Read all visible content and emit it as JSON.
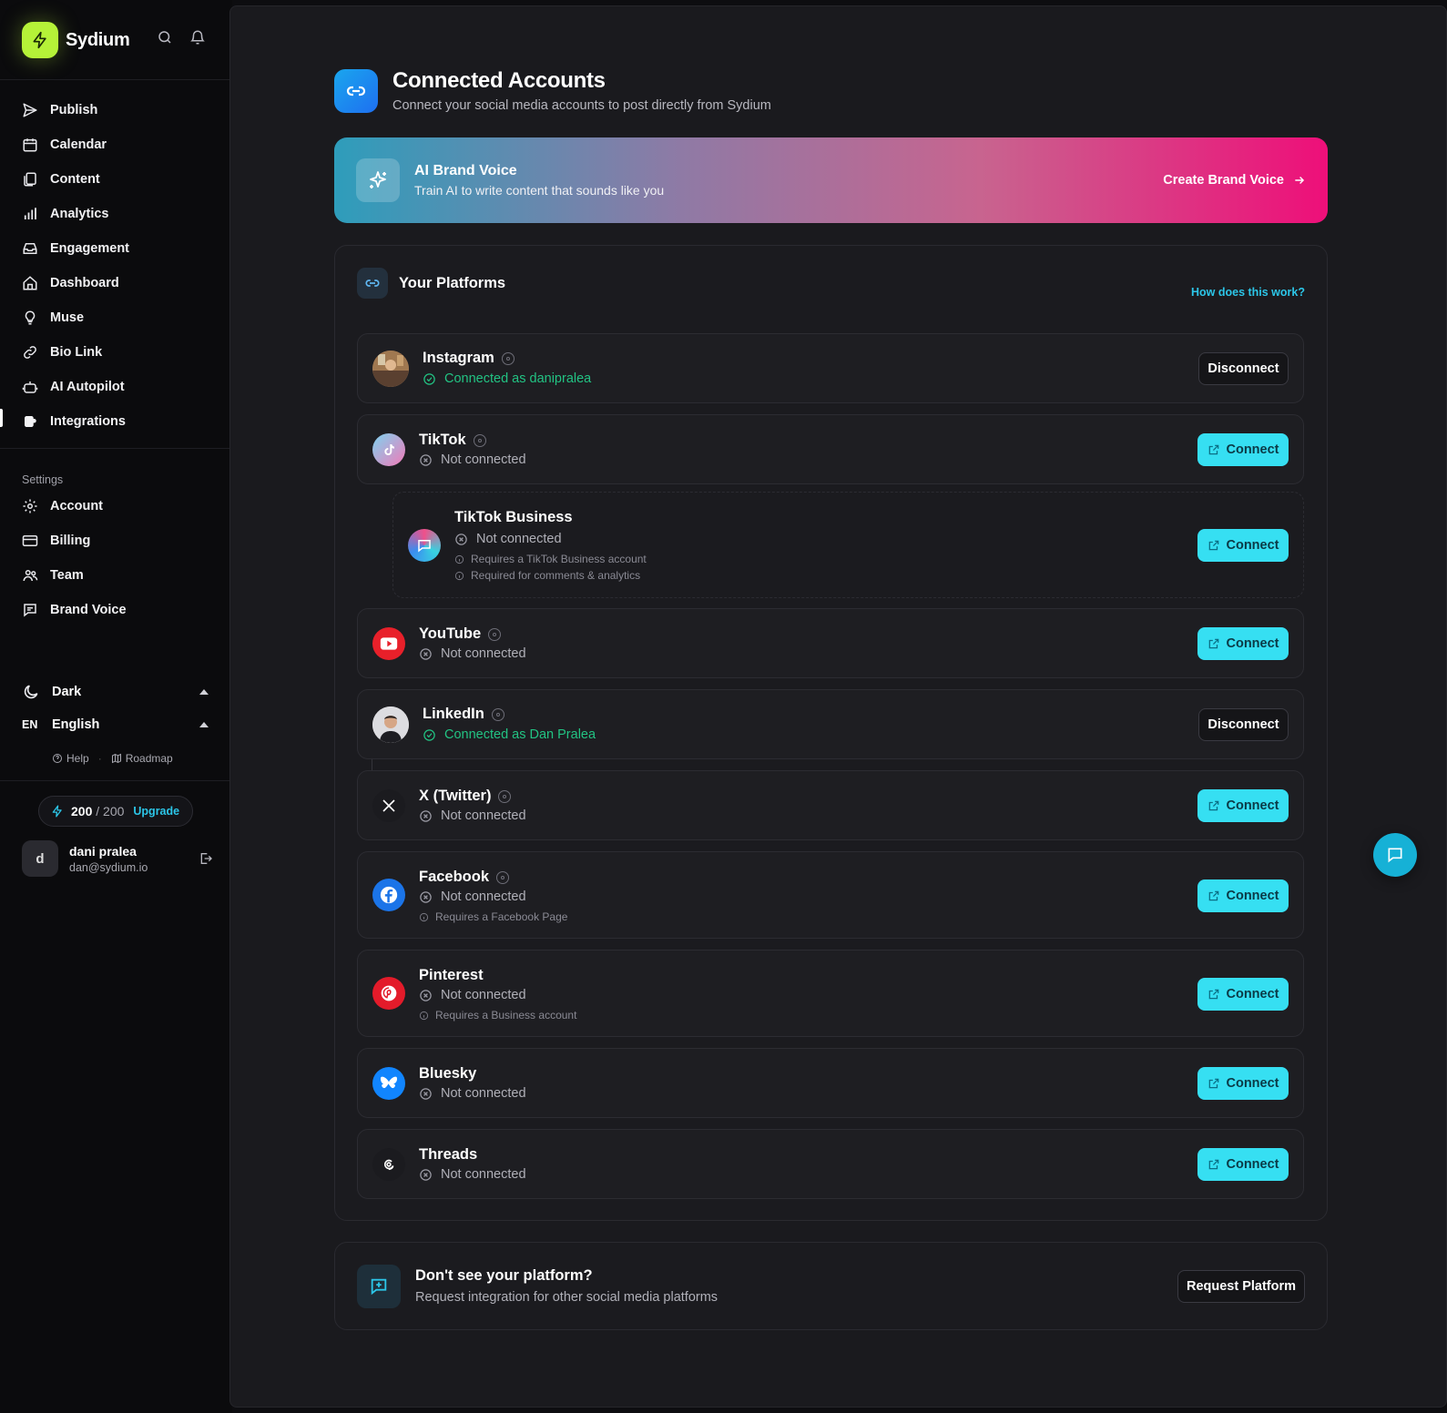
{
  "app": {
    "name": "Sydium"
  },
  "sidebar": {
    "nav": [
      {
        "label": "Publish",
        "icon": "send-icon"
      },
      {
        "label": "Calendar",
        "icon": "calendar-icon"
      },
      {
        "label": "Content",
        "icon": "documents-icon"
      },
      {
        "label": "Analytics",
        "icon": "bar-chart-icon"
      },
      {
        "label": "Engagement",
        "icon": "inbox-icon"
      },
      {
        "label": "Dashboard",
        "icon": "home-icon"
      },
      {
        "label": "Muse",
        "icon": "lightbulb-icon"
      },
      {
        "label": "Bio Link",
        "icon": "link-icon"
      },
      {
        "label": "AI Autopilot",
        "icon": "robot-icon"
      },
      {
        "label": "Integrations",
        "icon": "puzzle-icon",
        "active": true
      }
    ],
    "settings_label": "Settings",
    "settings": [
      {
        "label": "Account",
        "icon": "gear-icon"
      },
      {
        "label": "Billing",
        "icon": "credit-card-icon"
      },
      {
        "label": "Team",
        "icon": "users-icon"
      },
      {
        "label": "Brand Voice",
        "icon": "message-icon"
      }
    ],
    "theme": {
      "label": "Dark",
      "icon": "moon-icon"
    },
    "language": {
      "code": "EN",
      "label": "English"
    },
    "help": "Help",
    "roadmap": "Roadmap",
    "credits": {
      "used": "200",
      "total": "/ 200",
      "upgrade": "Upgrade"
    },
    "user": {
      "initial": "d",
      "name": "dani pralea",
      "email": "dan@sydium.io"
    }
  },
  "header": {
    "title": "Connected Accounts",
    "subtitle": "Connect your social media accounts to post directly from Sydium"
  },
  "banner": {
    "title": "AI Brand Voice",
    "subtitle": "Train AI to write content that sounds like you",
    "cta": "Create Brand Voice",
    "gradient": [
      "#2e9dbb",
      "#ee0f79"
    ]
  },
  "platforms": {
    "title": "Your Platforms",
    "help_link": "How does this work?",
    "items": [
      {
        "name": "Instagram",
        "status": "Connected as danipralea",
        "connected": true,
        "action": "Disconnect"
      },
      {
        "name": "TikTok",
        "status": "Not connected",
        "connected": false,
        "action": "Connect"
      },
      {
        "name": "TikTok Business",
        "status": "Not connected",
        "connected": false,
        "action": "Connect",
        "notes": [
          "Requires a TikTok Business account",
          "Required for comments & analytics"
        ]
      },
      {
        "name": "YouTube",
        "status": "Not connected",
        "connected": false,
        "action": "Connect"
      },
      {
        "name": "LinkedIn",
        "status": "Connected as Dan Pralea",
        "connected": true,
        "action": "Disconnect"
      },
      {
        "name": "X (Twitter)",
        "status": "Not connected",
        "connected": false,
        "action": "Connect"
      },
      {
        "name": "Facebook",
        "status": "Not connected",
        "connected": false,
        "action": "Connect",
        "notes": [
          "Requires a Facebook Page"
        ]
      },
      {
        "name": "Pinterest",
        "status": "Not connected",
        "connected": false,
        "action": "Connect",
        "notes": [
          "Requires a Business account"
        ]
      },
      {
        "name": "Bluesky",
        "status": "Not connected",
        "connected": false,
        "action": "Connect"
      },
      {
        "name": "Threads",
        "status": "Not connected",
        "connected": false,
        "action": "Connect"
      }
    ]
  },
  "footer": {
    "title": "Don't see your platform?",
    "subtitle": "Request integration for other social media platforms",
    "button": "Request Platform"
  },
  "colors": {
    "accent": "#36dff2",
    "connected": "#22c383",
    "brand": "#b5f238"
  }
}
